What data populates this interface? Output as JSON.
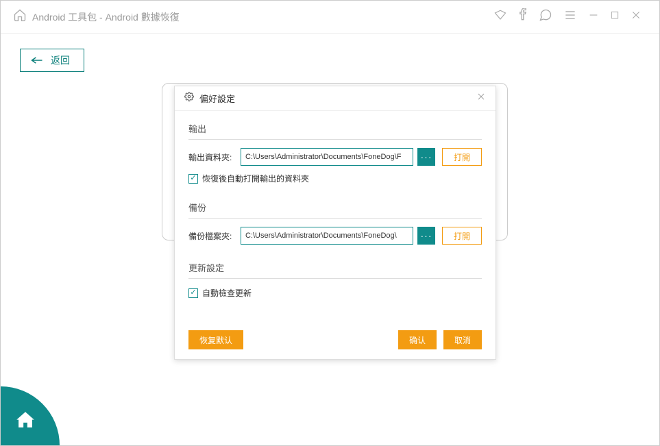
{
  "titlebar": {
    "title": "Android 工具包 - Android 數據恢復"
  },
  "back": {
    "label": "返回"
  },
  "dialog": {
    "title": "偏好設定",
    "output": {
      "section": "輸出",
      "folder_label": "輸出資料夾:",
      "folder_path": "C:\\Users\\Administrator\\Documents\\FoneDog\\F",
      "open_label": "打開",
      "auto_open_label": "恢復後自動打開輸出的資料夾"
    },
    "backup": {
      "section": "備份",
      "folder_label": "備份檔案夾:",
      "folder_path": "C:\\Users\\Administrator\\Documents\\FoneDog\\",
      "open_label": "打開"
    },
    "update": {
      "section": "更新設定",
      "auto_check_label": "自動檢查更新"
    },
    "buttons": {
      "restore_default": "恢复默认",
      "ok": "确认",
      "cancel": "取消"
    }
  }
}
